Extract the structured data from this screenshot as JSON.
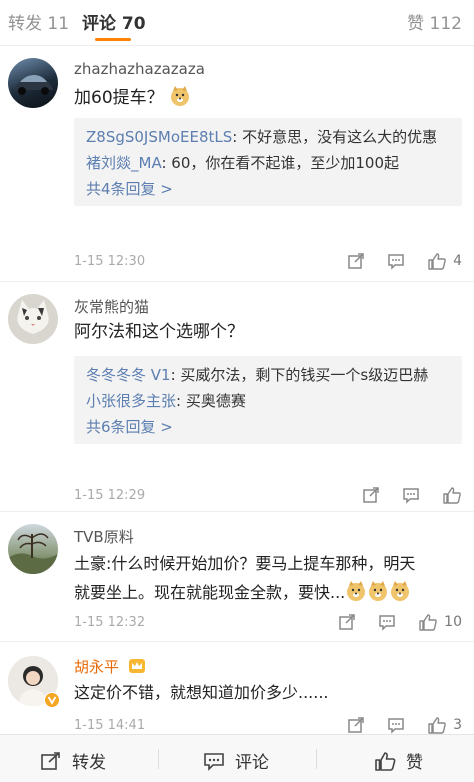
{
  "tabs": {
    "repost": "转发 11",
    "comments": "评论 70",
    "likes": "赞 112"
  },
  "comments": [
    {
      "username": "zhazhazhazazaza",
      "text": "加60提车？",
      "replies": [
        {
          "user": "Z8SgS0JSMoEE8tLS",
          "text": ": 不好意思，没有这么大的优惠"
        },
        {
          "user": "褚刘燚_MA",
          "text": ": 60，你在看不起谁，至少加100起"
        }
      ],
      "more_replies": "共4条回复 >",
      "time": "1-15 12:30",
      "likes": "4"
    },
    {
      "username": "灰常熊的猫",
      "text": "阿尔法和这个选哪个？",
      "replies": [
        {
          "user": "冬冬冬冬 V1",
          "text": ": 买威尔法，剩下的钱买一个s级迈巴赫"
        },
        {
          "user": "小张很多主张",
          "text": ": 买奥德赛"
        }
      ],
      "more_replies": "共6条回复 >",
      "time": "1-15 12:29",
      "likes": ""
    },
    {
      "username": "TVB原料",
      "text_line1": "土豪:什么时候开始加价？要马上提车那种，明天",
      "text_line2": "就要坐上。现在就能现金全款，要快...",
      "time": "1-15 12:32",
      "likes": "10"
    },
    {
      "username": "胡永平",
      "text": "这定价不错，就想知道加价多少......",
      "time": "1-15 14:41",
      "likes": "3"
    }
  ],
  "bottom_bar": {
    "repost": "转发",
    "comment": "评论",
    "like": "赞"
  },
  "colors": {
    "accent": "#ff8200",
    "link": "#5c7eb0",
    "username_vip": "#e86b0a"
  }
}
